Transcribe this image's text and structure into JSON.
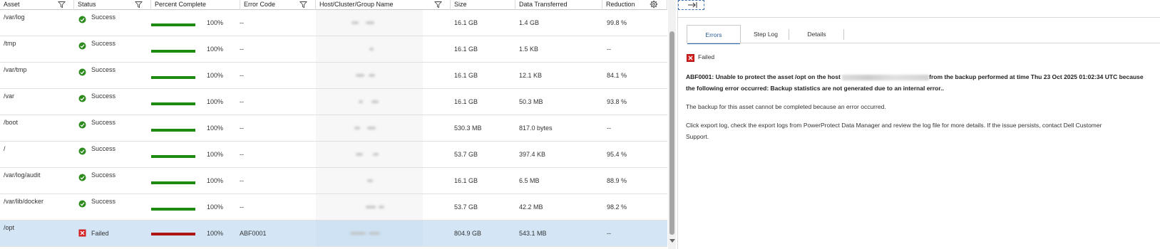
{
  "grid": {
    "columns": [
      {
        "key": "asset",
        "label": "Asset",
        "filter": true
      },
      {
        "key": "status",
        "label": "Status",
        "filter": true
      },
      {
        "key": "percent",
        "label": "Percent Complete",
        "filter": false
      },
      {
        "key": "error",
        "label": "Error Code",
        "filter": true
      },
      {
        "key": "host",
        "label": "Host/Cluster/Group Name",
        "filter": true
      },
      {
        "key": "size",
        "label": "Size",
        "filter": false
      },
      {
        "key": "data",
        "label": "Data Transferred",
        "filter": false
      },
      {
        "key": "reduction",
        "label": "Reduction",
        "filter": false
      }
    ],
    "settings_icon": "gear-icon",
    "rows": [
      {
        "asset": "/var/log",
        "status": "Success",
        "percent": "100%",
        "progress": 1.0,
        "error": "--",
        "size": "16.1 GB",
        "data": "1.4 GB",
        "reduction": "99.8 %"
      },
      {
        "asset": "/tmp",
        "status": "Success",
        "percent": "100%",
        "progress": 1.0,
        "error": "--",
        "size": "16.1 GB",
        "data": "1.5 KB",
        "reduction": "--"
      },
      {
        "asset": "/var/tmp",
        "status": "Success",
        "percent": "100%",
        "progress": 1.0,
        "error": "--",
        "size": "16.1 GB",
        "data": "12.1 KB",
        "reduction": "84.1 %"
      },
      {
        "asset": "/var",
        "status": "Success",
        "percent": "100%",
        "progress": 1.0,
        "error": "--",
        "size": "16.1 GB",
        "data": "50.3 MB",
        "reduction": "93.8 %"
      },
      {
        "asset": "/boot",
        "status": "Success",
        "percent": "100%",
        "progress": 1.0,
        "error": "--",
        "size": "530.3 MB",
        "data": "817.0 bytes",
        "reduction": "--"
      },
      {
        "asset": "/",
        "status": "Success",
        "percent": "100%",
        "progress": 1.0,
        "error": "--",
        "size": "53.7 GB",
        "data": "397.4 KB",
        "reduction": "95.4 %"
      },
      {
        "asset": "/var/log/audit",
        "status": "Success",
        "percent": "100%",
        "progress": 1.0,
        "error": "--",
        "size": "16.1 GB",
        "data": "6.5 MB",
        "reduction": "88.9 %"
      },
      {
        "asset": "/var/lib/docker",
        "status": "Success",
        "percent": "100%",
        "progress": 1.0,
        "error": "--",
        "size": "53.7 GB",
        "data": "42.2 MB",
        "reduction": "98.2 %"
      },
      {
        "asset": "/opt",
        "status": "Failed",
        "percent": "100%",
        "progress": 1.0,
        "error": "ABF0001",
        "size": "804.9 GB",
        "data": "543.1 MB",
        "reduction": "--",
        "selected": true
      }
    ],
    "colors": {
      "success": "#2e8b1e",
      "failed": "#d32020",
      "success_bar": "#1f8a10",
      "failed_bar": "#b01515"
    }
  },
  "panel": {
    "collapse_icon": "collapse-right-icon",
    "tabs": [
      "Errors",
      "Step Log",
      "Details"
    ],
    "active_tab": "Errors",
    "status_label": "Failed",
    "error_line1": "ABF0001: Unable to protect the asset /opt on the host",
    "error_line1b": "from the backup performed at time Thu 23 Oct 2025 01:02:34 UTC because",
    "error_line2": "the following error occurred: Backup statistics are not generated due to an internal error..",
    "message1": "The backup for this asset cannot be completed because an error occurred.",
    "message2a": " Click export log, check the export logs from PowerProtect Data Manager and review the log file for more details. If the issue persists, contact Dell Customer",
    "message2b": "Support."
  }
}
